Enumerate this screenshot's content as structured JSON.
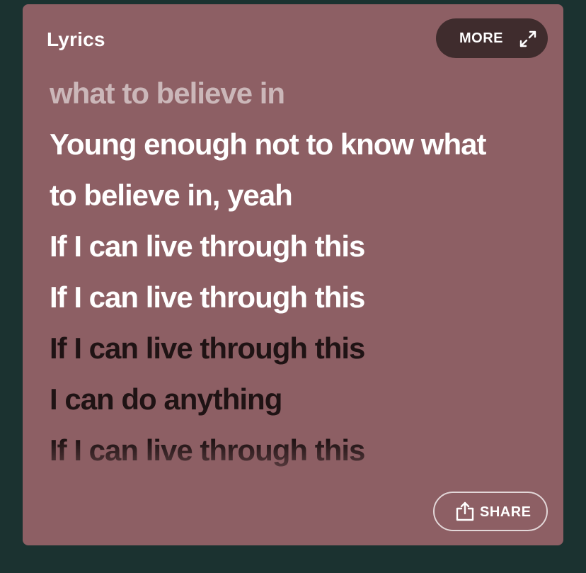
{
  "panel": {
    "title": "Lyrics",
    "more_label": "MORE",
    "expand_icon": "expand-icon",
    "share_label": "SHARE",
    "share_icon": "share-icon"
  },
  "lyrics": {
    "lines": [
      {
        "text": "what to believe in",
        "state": "past"
      },
      {
        "text": "Young enough not to know what",
        "state": "sung"
      },
      {
        "text": "to believe in, yeah",
        "state": "sung"
      },
      {
        "text": "If I can live through this",
        "state": "sung"
      },
      {
        "text": "If I can live through this",
        "state": "sung"
      },
      {
        "text": "If I can live through this",
        "state": "upcoming"
      },
      {
        "text": "I can do anything",
        "state": "upcoming"
      },
      {
        "text": "If I can live through this",
        "state": "upcoming"
      }
    ]
  },
  "colors": {
    "page_background": "#1b3230",
    "card_background": "#8d5f64",
    "more_button": "#3f2c2d",
    "sung_text": "#ffffff",
    "upcoming_text": "#1f1314"
  }
}
